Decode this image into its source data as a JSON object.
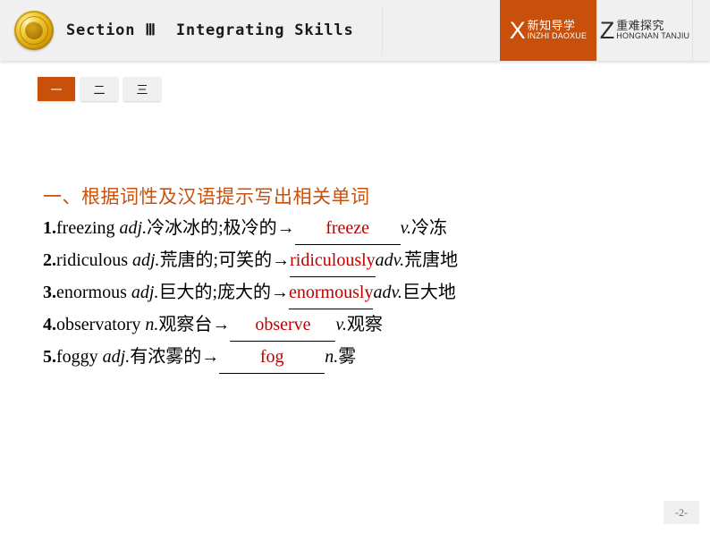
{
  "header": {
    "emblem_icon": "gold-medal-emblem",
    "title": "Section Ⅲ  Integrating Skills",
    "nav_tabs": [
      {
        "letter": "X",
        "cn": "新知导学",
        "pinyin": "INZHI DAOXUE",
        "active": true
      },
      {
        "letter": "Z",
        "cn": "重难探究",
        "pinyin": "HONGNAN TANJIU",
        "active": false
      }
    ]
  },
  "subtabs": [
    {
      "label": "一",
      "active": true
    },
    {
      "label": "二",
      "active": false
    },
    {
      "label": "三",
      "active": false
    }
  ],
  "main": {
    "section_heading": "一、根据词性及汉语提示写出相关单词",
    "items": [
      {
        "num": "1.",
        "word": "freezing",
        "pos1": "adj.",
        "meaning1": "冷冰冰的;极冷的",
        "arrow": "→",
        "answer": "freeze",
        "pos2": "v.",
        "meaning2": "冷冻"
      },
      {
        "num": "2.",
        "word": "ridiculous",
        "pos1": "adj.",
        "meaning1": "荒唐的;可笑的",
        "arrow": "→",
        "answer": "ridiculously",
        "pos2": "adv.",
        "meaning2": "荒唐地"
      },
      {
        "num": "3.",
        "word": "enormous",
        "pos1": "adj.",
        "meaning1": "巨大的;庞大的",
        "arrow": "→",
        "answer": "enormously",
        "pos2": "adv.",
        "meaning2": "巨大地"
      },
      {
        "num": "4.",
        "word": "observatory",
        "pos1": "n.",
        "meaning1": "观察台",
        "arrow": "→",
        "answer": "observe",
        "pos2": "v.",
        "meaning2": "观察"
      },
      {
        "num": "5.",
        "word": "foggy",
        "pos1": "adj.",
        "meaning1": "有浓雾的",
        "arrow": "→",
        "answer": "fog",
        "pos2": "n.",
        "meaning2": "雾"
      }
    ]
  },
  "footer": {
    "page_number": "-2-"
  },
  "colors": {
    "accent_orange": "#c8500a",
    "answer_red": "#c00000",
    "header_bg": "#f0f0f0"
  }
}
